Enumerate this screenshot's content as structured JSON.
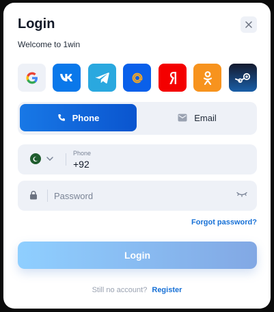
{
  "header": {
    "title": "Login",
    "subtitle": "Welcome to 1win"
  },
  "icons": {
    "close": "close-icon",
    "social": [
      "google-icon",
      "vk-icon",
      "telegram-icon",
      "mail-ru-icon",
      "yandex-icon",
      "odnoklassniki-icon",
      "steam-icon"
    ],
    "phone_tab": "phone-icon",
    "email_tab": "email-icon",
    "lock": "lock-icon",
    "eye": "eye-hidden-icon",
    "chevron": "chevron-down-icon",
    "flag": "pakistan-flag-icon"
  },
  "tabs": {
    "phone": "Phone",
    "email": "Email",
    "active": "Phone"
  },
  "phone": {
    "label": "Phone",
    "value": "+92"
  },
  "password": {
    "placeholder": "Password"
  },
  "links": {
    "forgot": "Forgot password?"
  },
  "actions": {
    "login": "Login"
  },
  "footer": {
    "prompt": "Still no account?",
    "register": "Register"
  },
  "colors": {
    "accent": "#1670d6",
    "tab_active": "#0a55cf",
    "field_bg": "#eef1f7",
    "login_gradient_start": "#8fcfff",
    "login_gradient_end": "#82a8e4"
  }
}
